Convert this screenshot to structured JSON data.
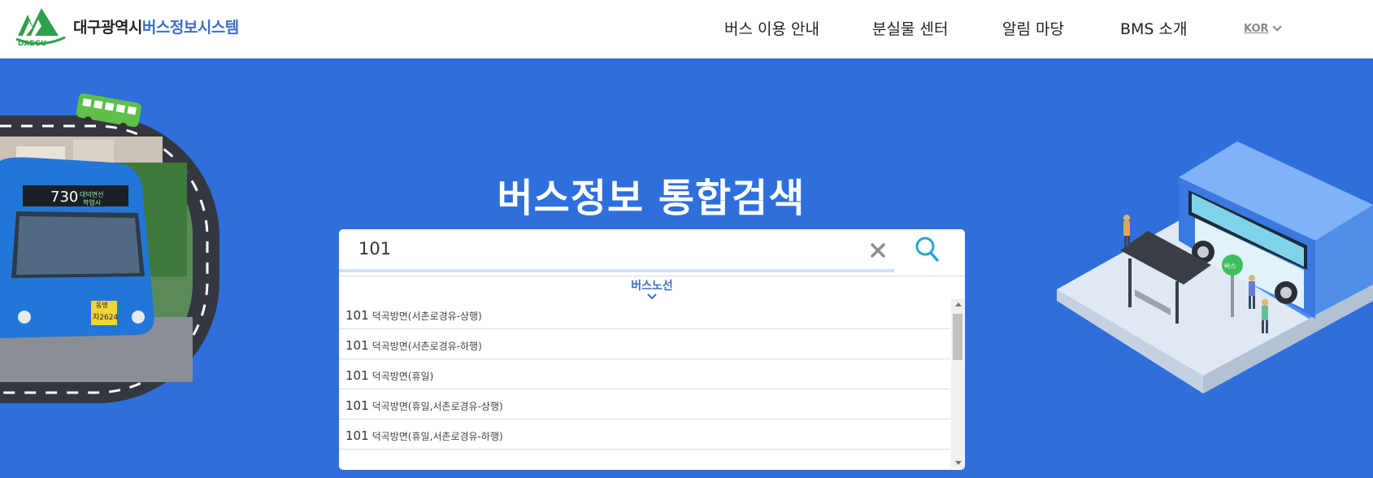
{
  "header": {
    "logo_text": "DAEGU",
    "brand_prefix": "대구광역시",
    "brand_suffix": "버스정보시스템",
    "nav": [
      {
        "label": "버스 이용 안내"
      },
      {
        "label": "분실물 센터"
      },
      {
        "label": "알림 마당"
      },
      {
        "label": "BMS 소개"
      }
    ],
    "language": "KOR"
  },
  "hero": {
    "title": "버스정보 통합검색"
  },
  "search": {
    "value": "101",
    "section_label": "버스노선",
    "results": [
      {
        "number": "101",
        "name": "덕곡방면(서촌로경유-상행)"
      },
      {
        "number": "101",
        "name": "덕곡방면(서촌로경유-하행)"
      },
      {
        "number": "101",
        "name": "덕곡방면(휴일)"
      },
      {
        "number": "101",
        "name": "덕곡방면(휴일,서촌로경유-상행)"
      },
      {
        "number": "101",
        "name": "덕곡방면(휴일,서촌로경유-하행)"
      }
    ]
  },
  "illustration": {
    "bus_route_sign": "730",
    "bus_destination": "대덕면선",
    "bus_destination2": "학영시",
    "bus_plate": "자2624",
    "bus_front_label": "동명",
    "bus_stop_sign": "버스"
  },
  "colors": {
    "background": "#2f6fdc",
    "accent": "#3d6fc6",
    "logo_green": "#2ea04a"
  }
}
